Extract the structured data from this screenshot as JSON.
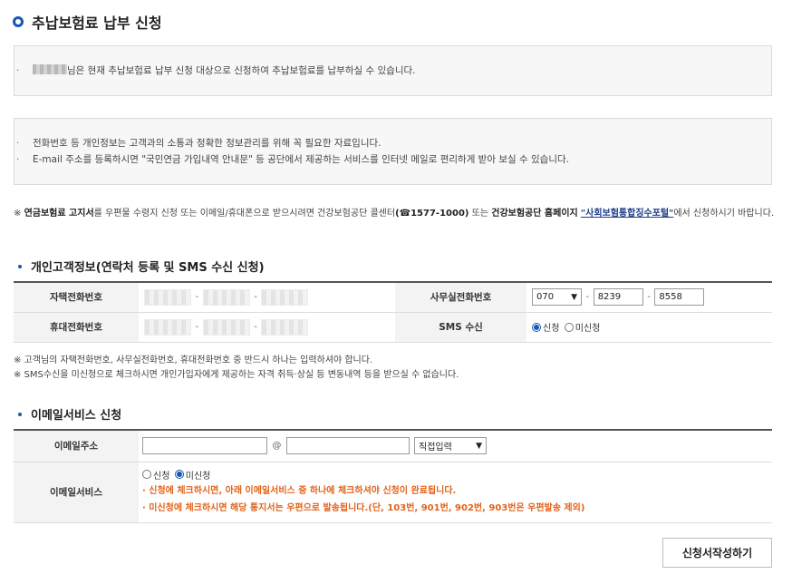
{
  "page": {
    "title": "추납보험료 납부 신청"
  },
  "eligibility_box": {
    "message": "님은 현재 추납보험료 납부 신청 대상으로 신청하여 추납보험료를 납부하실 수 있습니다."
  },
  "privacy_box": {
    "items": [
      "전화번호 등 개인정보는 고객과의 소통과 정확한 정보관리를 위해 꼭 필요한 자료입니다.",
      "E-mail 주소를 등록하시면 \"국민연금 가입내역 안내문\" 등 공단에서 제공하는 서비스를 인터넷 메일로 편리하게 받아 보실 수 있습니다."
    ]
  },
  "notice": {
    "prefix": "※ ",
    "bold1": "연금보험료 고지서",
    "text1": "를 우편물 수령지 신청 또는 이메일/휴대폰으로 받으시려면 건강보험공단 콜센터",
    "bold2": "(☎1577-1000)",
    "text2": " 또는 ",
    "bold3": "건강보험공단 홈페이지",
    "text3": " ",
    "link": "\"사회보험통합징수포털\"",
    "text4": "에서 신청하시기 바랍니다."
  },
  "contact_section": {
    "title": "개인고객정보(연락처 등록 및 SMS 수신 신청)",
    "home_phone_label": "자택전화번호",
    "office_phone_label": "사무실전화번호",
    "office_phone": {
      "area": "070",
      "mid": "8239",
      "last": "8558",
      "sep": "-"
    },
    "mobile_label": "휴대전화번호",
    "sms_label": "SMS 수신",
    "sms_options": [
      "신청",
      "미신청"
    ],
    "sms_selected": "신청"
  },
  "contact_notes": [
    "※ 고객님의 자택전화번호, 사무실전화번호, 휴대전화번호 중 반드시 하나는 입력하셔야 합니다.",
    "※ SMS수신을 미신청으로 체크하시면 개인가입자에게 제공하는 자격 취득·상실 등 변동내역 등을 받으실 수 없습니다."
  ],
  "email_section": {
    "title": "이메일서비스 신청",
    "address_label": "이메일주소",
    "at_sign": "@",
    "domain_select": "직접입력",
    "service_label": "이메일서비스",
    "service_options": [
      "신청",
      "미신청"
    ],
    "service_selected": "미신청",
    "notes": [
      "· 신청에 체크하시면, 아래 이메일서비스 중 하나에 체크하셔야 신청이 완료됩니다.",
      "· 미신청에 체크하시면 해당 통지서는 우편으로 발송됩니다.(단, 103번, 901번, 902번, 903번은 우편발송 제외)"
    ]
  },
  "submit_button": "신청서작성하기",
  "colors": {
    "accent": "#1a56b0",
    "warning": "#e2631a"
  },
  "icons": {
    "title": "ring-bullet-icon",
    "select": "chevron-down-icon"
  }
}
